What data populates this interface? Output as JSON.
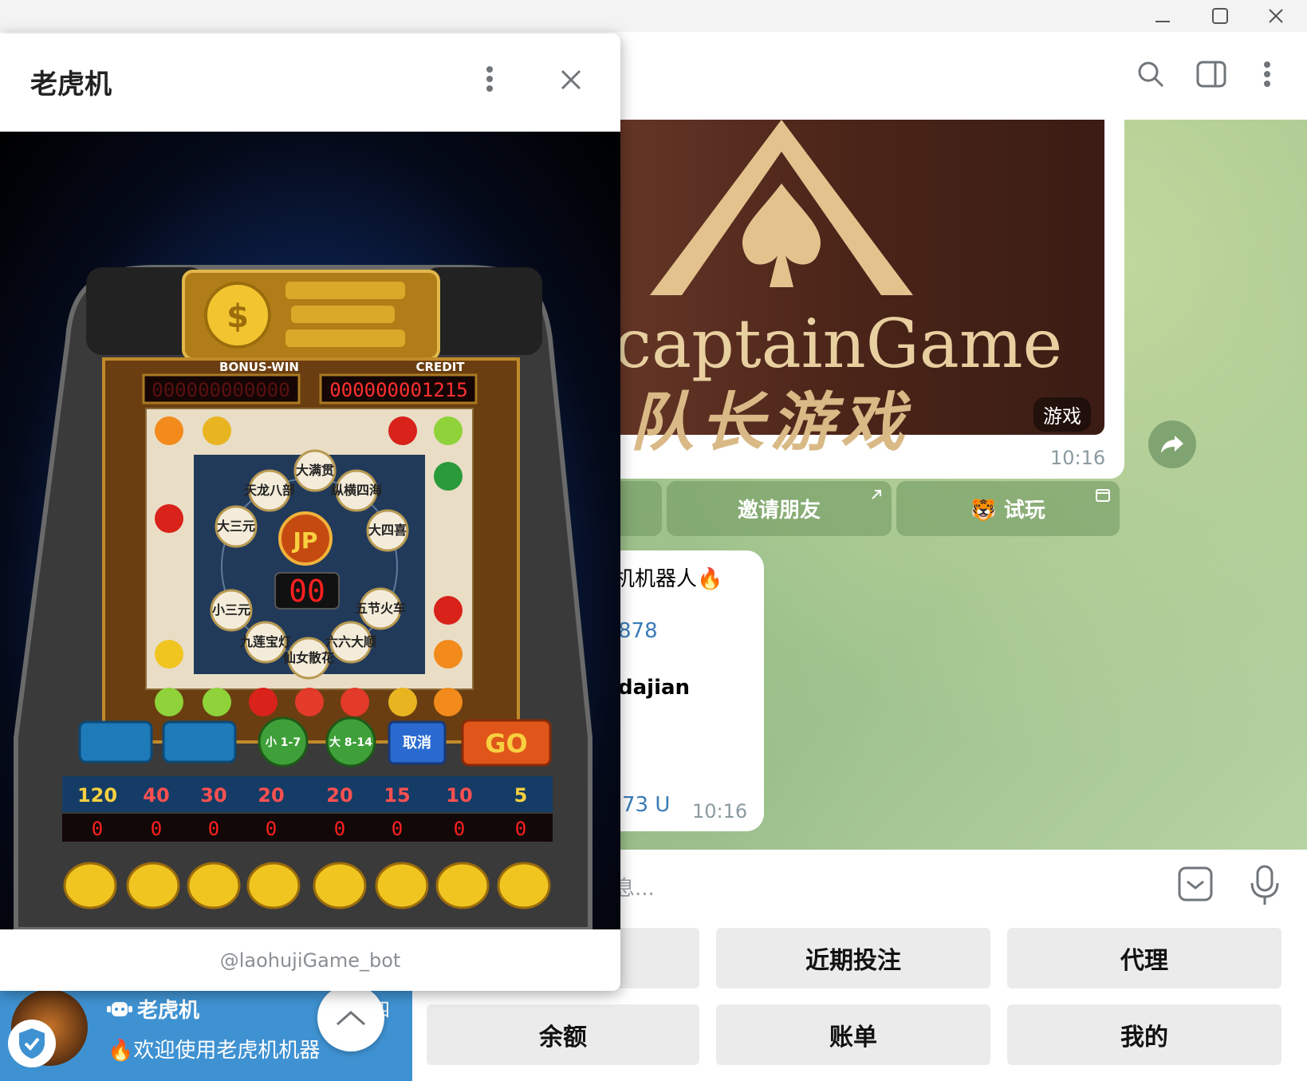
{
  "window": {
    "minimize": "—",
    "maximize": "☐",
    "close": "✕"
  },
  "chat": {
    "image_message": {
      "promo_latin": "captainGame",
      "promo_cn": "队长游戏",
      "tag": "游戏",
      "time": "10:16"
    },
    "inline_buttons": [
      {
        "label": "邀请朋友",
        "icon": "external-link-icon"
      },
      {
        "label": "🐯 试玩",
        "icon": "webapp-icon"
      }
    ],
    "text_message": {
      "line1": "机机器人🔥",
      "line2": "878",
      "line3": "dajian",
      "line4": "73  U",
      "time": "10:16"
    },
    "composer_placeholder": "息..."
  },
  "keyboard": {
    "row1": [
      "近期投注",
      "代理"
    ],
    "row2": [
      "余额",
      "账单",
      "我的"
    ]
  },
  "sidebar_item": {
    "name": "老虎机",
    "preview": "🔥欢迎使用老虎机机器",
    "date": "四"
  },
  "popup": {
    "title": "老虎机",
    "footer": "@laohujiGame_bot",
    "game": {
      "label_bonus": "BONUS-WIN",
      "label_credit": "CREDIT",
      "bonus_display": "000000000000",
      "credit_display": "000000001215",
      "center_display": "00",
      "jp": "JP",
      "ring": [
        "大满贯",
        "纵横四海",
        "大四喜",
        "五节火车",
        "六六大顺",
        "仙女散花",
        "九莲宝灯",
        "小三元",
        "大三元",
        "天龙八部"
      ],
      "controls": [
        "小 1-7",
        "大 8-14",
        "取消",
        "GO"
      ],
      "odds": [
        "120",
        "40",
        "30",
        "20",
        "20",
        "15",
        "10",
        "5"
      ],
      "bets": [
        "0",
        "0",
        "0",
        "0",
        "0",
        "0",
        "0",
        "0"
      ]
    }
  },
  "colors": {
    "accent": "#3f92d2",
    "inline_button": "#7ca36b",
    "keyboard_button": "#ebebeb"
  }
}
